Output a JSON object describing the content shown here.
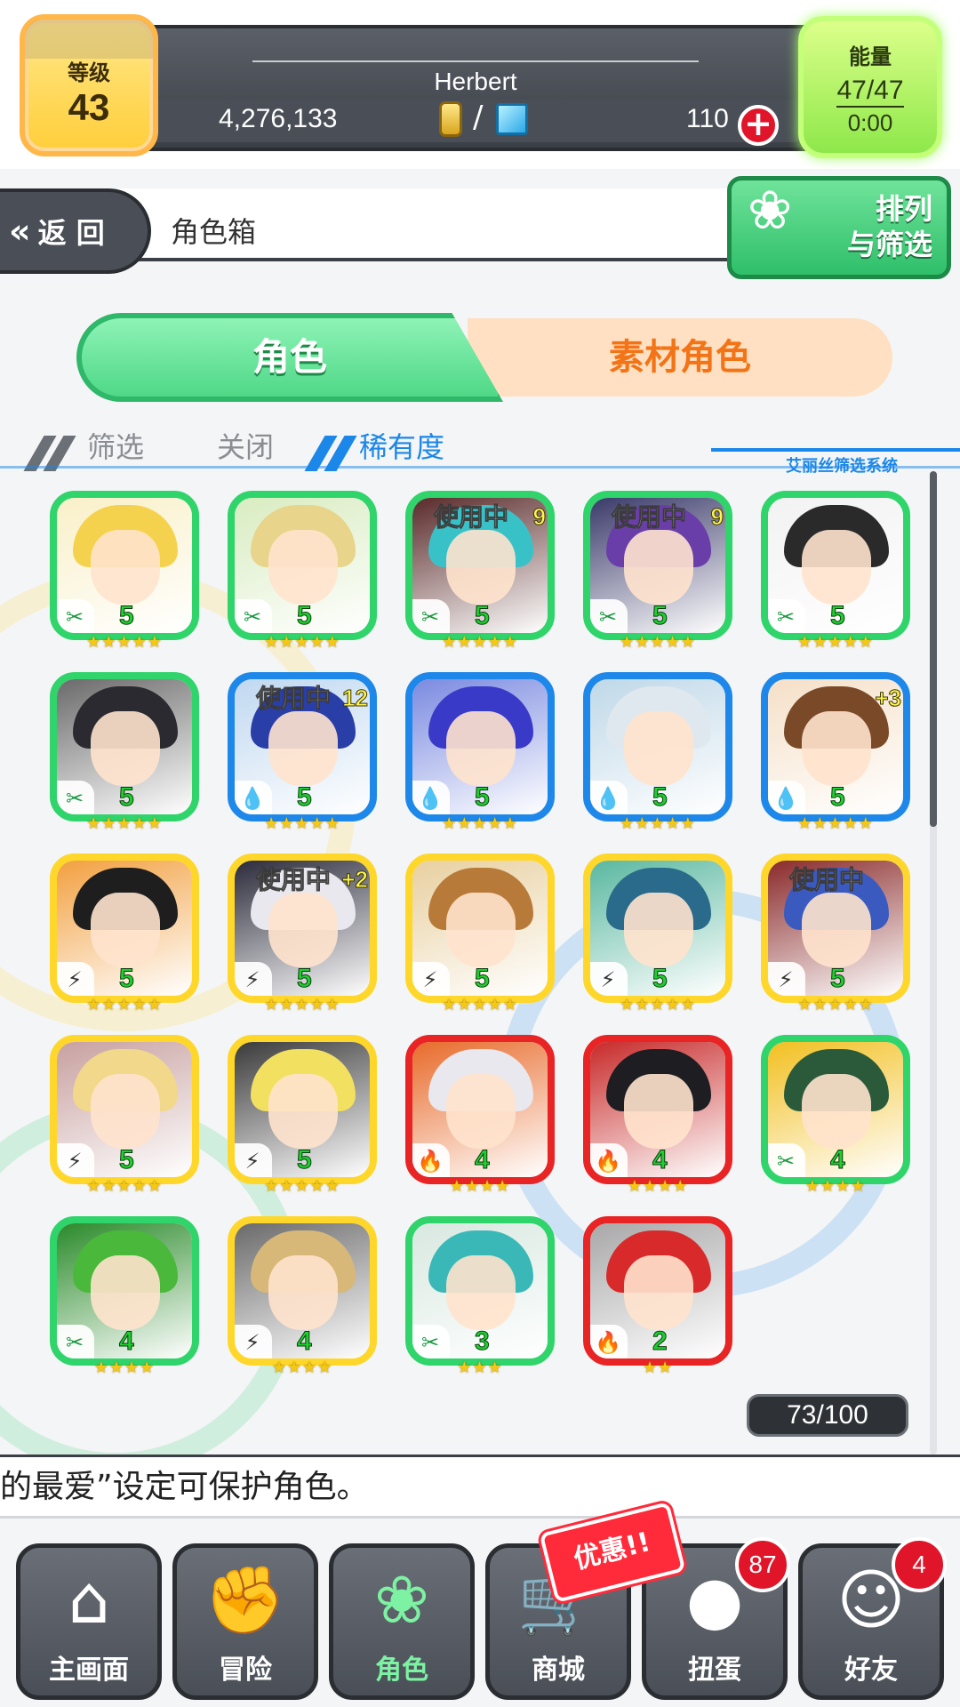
{
  "status": {
    "level_label": "等级",
    "level_value": "43",
    "player_name": "Herbert",
    "coins": "4,276,133",
    "gems": "110",
    "energy_label": "能量",
    "energy_value": "47/47",
    "energy_timer": "0:00"
  },
  "header": {
    "back_label": "返 回",
    "title": "角色箱",
    "sort_label_line1": "排列",
    "sort_label_line2": "与筛选"
  },
  "tabs": {
    "characters": "角色",
    "material": "素材角色"
  },
  "filter": {
    "label": "筛选",
    "state": "关闭",
    "sort_by": "稀有度",
    "system_label": "艾丽丝筛选系统"
  },
  "status_text": {
    "in_use": "使用中"
  },
  "characters": [
    {
      "element": "wood",
      "rank": "5",
      "stars": "★★★★★",
      "in_use": "",
      "plus": "",
      "hair": "#f5d24e",
      "bg": "#f9f0c8"
    },
    {
      "element": "wood",
      "rank": "5",
      "stars": "★★★★★",
      "in_use": "",
      "plus": "",
      "hair": "#e8d48a",
      "bg": "#d8ecc0"
    },
    {
      "element": "wood",
      "rank": "5",
      "stars": "★★★★★",
      "in_use": "使用中",
      "plus": "9",
      "hair": "#38c2c8",
      "bg": "#5a2a2a"
    },
    {
      "element": "wood",
      "rank": "5",
      "stars": "★★★★★",
      "in_use": "使用中",
      "plus": "9",
      "hair": "#6a3ea8",
      "bg": "#3a3a6a"
    },
    {
      "element": "wood",
      "rank": "5",
      "stars": "★★★★★",
      "in_use": "",
      "plus": "",
      "hair": "#2a2a2a",
      "bg": "#f2f2f2"
    },
    {
      "element": "wood",
      "rank": "5",
      "stars": "★★★★★",
      "in_use": "",
      "plus": "",
      "hair": "#2a2a30",
      "bg": "#6a6a6a"
    },
    {
      "element": "water",
      "rank": "5",
      "stars": "★★★★★",
      "in_use": "使用中",
      "plus": "12",
      "hair": "#2a3ea8",
      "bg": "#c0d8f0"
    },
    {
      "element": "water",
      "rank": "5",
      "stars": "★★★★★",
      "in_use": "",
      "plus": "",
      "hair": "#3a3ac8",
      "bg": "#7a8ae0"
    },
    {
      "element": "water",
      "rank": "5",
      "stars": "★★★★★",
      "in_use": "",
      "plus": "",
      "hair": "#dfe8ee",
      "bg": "#bfd8e8"
    },
    {
      "element": "water",
      "rank": "5",
      "stars": "★★★★★",
      "in_use": "",
      "plus": "+3",
      "hair": "#7a4a28",
      "bg": "#f5e0c8"
    },
    {
      "element": "light",
      "rank": "5",
      "stars": "★★★★★",
      "in_use": "",
      "plus": "",
      "hair": "#1e1e1e",
      "bg": "#f2a040"
    },
    {
      "element": "light",
      "rank": "5",
      "stars": "★★★★★",
      "in_use": "使用中",
      "plus": "+2",
      "hair": "#e8e8ee",
      "bg": "#2a2a3a"
    },
    {
      "element": "light",
      "rank": "5",
      "stars": "★★★★★",
      "in_use": "",
      "plus": "",
      "hair": "#b87a38",
      "bg": "#e8d0a0"
    },
    {
      "element": "light",
      "rank": "5",
      "stars": "★★★★★",
      "in_use": "",
      "plus": "",
      "hair": "#2a6a8a",
      "bg": "#5ab8a0"
    },
    {
      "element": "light",
      "rank": "5",
      "stars": "★★★★★",
      "in_use": "使用中",
      "plus": "",
      "hair": "#3a5ac0",
      "bg": "#8a2a2a"
    },
    {
      "element": "light",
      "rank": "5",
      "stars": "★★★★★",
      "in_use": "",
      "plus": "",
      "hair": "#f2d88a",
      "bg": "#c8a0a0"
    },
    {
      "element": "light",
      "rank": "5",
      "stars": "★★★★★",
      "in_use": "",
      "plus": "",
      "hair": "#f2e060",
      "bg": "#3a3a3a"
    },
    {
      "element": "fire",
      "rank": "4",
      "stars": "★★★★",
      "in_use": "",
      "plus": "",
      "hair": "#e8e8ee",
      "bg": "#e86a2a"
    },
    {
      "element": "fire",
      "rank": "4",
      "stars": "★★★★",
      "in_use": "",
      "plus": "",
      "hair": "#1e1e22",
      "bg": "#c82a2a"
    },
    {
      "element": "wood",
      "rank": "4",
      "stars": "★★★★",
      "in_use": "",
      "plus": "",
      "hair": "#2a5a3a",
      "bg": "#f2c020"
    },
    {
      "element": "wood",
      "rank": "4",
      "stars": "★★★★",
      "in_use": "",
      "plus": "",
      "hair": "#4ab83a",
      "bg": "#2a8a2a"
    },
    {
      "element": "light",
      "rank": "4",
      "stars": "★★★★",
      "in_use": "",
      "plus": "",
      "hair": "#d8b878",
      "bg": "#6a6a6a"
    },
    {
      "element": "wood",
      "rank": "3",
      "stars": "★★★",
      "in_use": "",
      "plus": "",
      "hair": "#3ab8b8",
      "bg": "#d8e8e0"
    },
    {
      "element": "fire",
      "rank": "2",
      "stars": "★★",
      "in_use": "",
      "plus": "",
      "hair": "#d82a2a",
      "bg": "#a8a8a8"
    }
  ],
  "box_count": "73/100",
  "tip": "的最爱”设定可保护角色。",
  "nav": [
    {
      "label": "主画面",
      "icon": "home-icon",
      "glyph": "⌂",
      "badge": ""
    },
    {
      "label": "冒险",
      "icon": "handshake-icon",
      "glyph": "✊",
      "badge": ""
    },
    {
      "label": "角色",
      "icon": "bunny-icon",
      "glyph": "❀",
      "badge": ""
    },
    {
      "label": "商城",
      "icon": "cart-icon",
      "glyph": "🛒",
      "badge": ""
    },
    {
      "label": "扭蛋",
      "icon": "egg-icon",
      "glyph": "●",
      "badge": "87"
    },
    {
      "label": "好友",
      "icon": "friends-icon",
      "glyph": "☺",
      "badge": "4"
    }
  ],
  "sale_label": "优惠!!",
  "colors": {
    "wood": "#2fd46a",
    "water": "#1e88ea",
    "light": "#ffd72a",
    "fire": "#e82424",
    "accent_orange": "#f37416",
    "accent_green": "#4fd887"
  }
}
